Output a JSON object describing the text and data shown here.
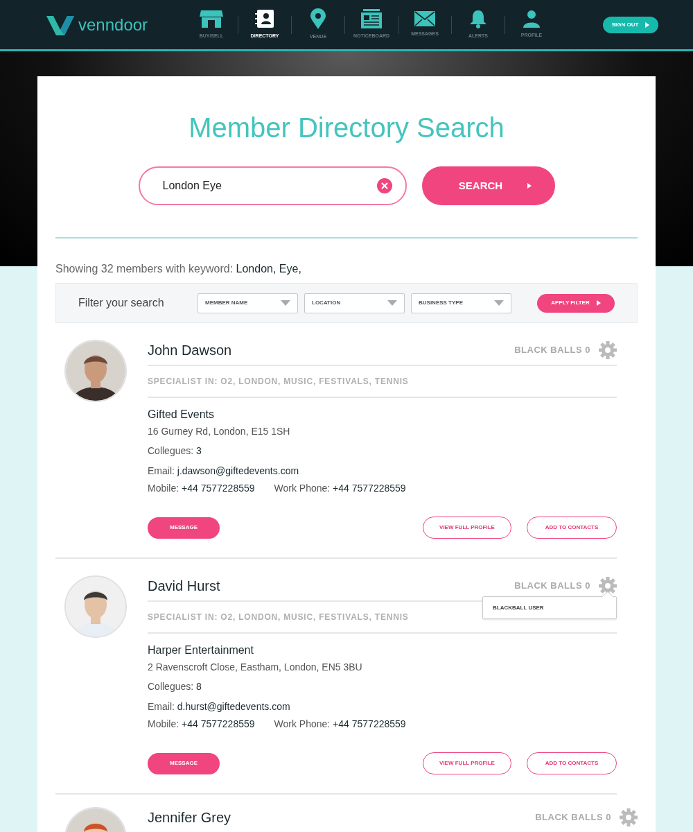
{
  "nav": {
    "logo": "venndoor",
    "items": [
      {
        "label": "BUY/SELL",
        "selected": false
      },
      {
        "label": "DIRECTORY",
        "selected": true
      },
      {
        "label": "VENUE",
        "selected": false
      },
      {
        "label": "NOTICEBOARD",
        "selected": false
      },
      {
        "label": "MESSAGES",
        "selected": false
      },
      {
        "label": "ALERTS",
        "selected": false
      },
      {
        "label": "PROFILE",
        "selected": false
      }
    ],
    "sign_out": "SIGN OUT"
  },
  "title": "Member Directory Search",
  "search": {
    "value": "London Eye",
    "button": "SEARCH"
  },
  "summary": "Showing 32 members with keyword: **London, Eye,**",
  "filter": {
    "label": "Filter your search",
    "dropdowns": [
      "MEMBER NAME",
      "LOCATION",
      "BUSINESS TYPE"
    ],
    "button": "APPLY FILTER"
  },
  "members": [
    {
      "name": "John Dawson",
      "black_balls": "BLACK BALLS 0",
      "specialist": "SPECIALIST IN: O2, LONDON, MUSIC, FESTIVALS, TENNIS",
      "company": "Gifted Events",
      "address": "16 Gurney Rd, London, E15 1SH",
      "colleagues": {
        "label": "Collegues:",
        "value": "3"
      },
      "email": {
        "label": "Email:",
        "value": "j.dawson@giftedevents.com"
      },
      "mobile": {
        "label": "Mobile:",
        "value": "+44 7577228559"
      },
      "work_phone": {
        "label": "Work Phone:",
        "value": "+44 7577228559"
      },
      "buttons": [
        "MESSAGE",
        "VIEW FULL PROFILE",
        "ADD TO CONTACTS"
      ]
    },
    {
      "name": "David Hurst",
      "black_balls": "BLACK BALLS 0",
      "menu": [
        "BLACKBALL USER"
      ],
      "specialist": "SPECIALIST IN: O2, LONDON, MUSIC, FESTIVALS, TENNIS",
      "company": "Harper Entertainment",
      "address": "2 Ravenscroft Close, Eastham, London, EN5 3BU",
      "colleagues": {
        "label": "Collegues:",
        "value": "8"
      },
      "email": {
        "label": "Email:",
        "value": "d.hurst@giftedevents.com"
      },
      "mobile": {
        "label": "Mobile:",
        "value": "+44 7577228559"
      },
      "work_phone": {
        "label": "Work Phone:",
        "value": "+44 7577228559"
      },
      "buttons": [
        "MESSAGE",
        "VIEW FULL PROFILE",
        "ADD TO CONTACTS"
      ]
    },
    {
      "name": "Jennifer Grey",
      "black_balls": "BLACK BALLS 0"
    }
  ]
}
